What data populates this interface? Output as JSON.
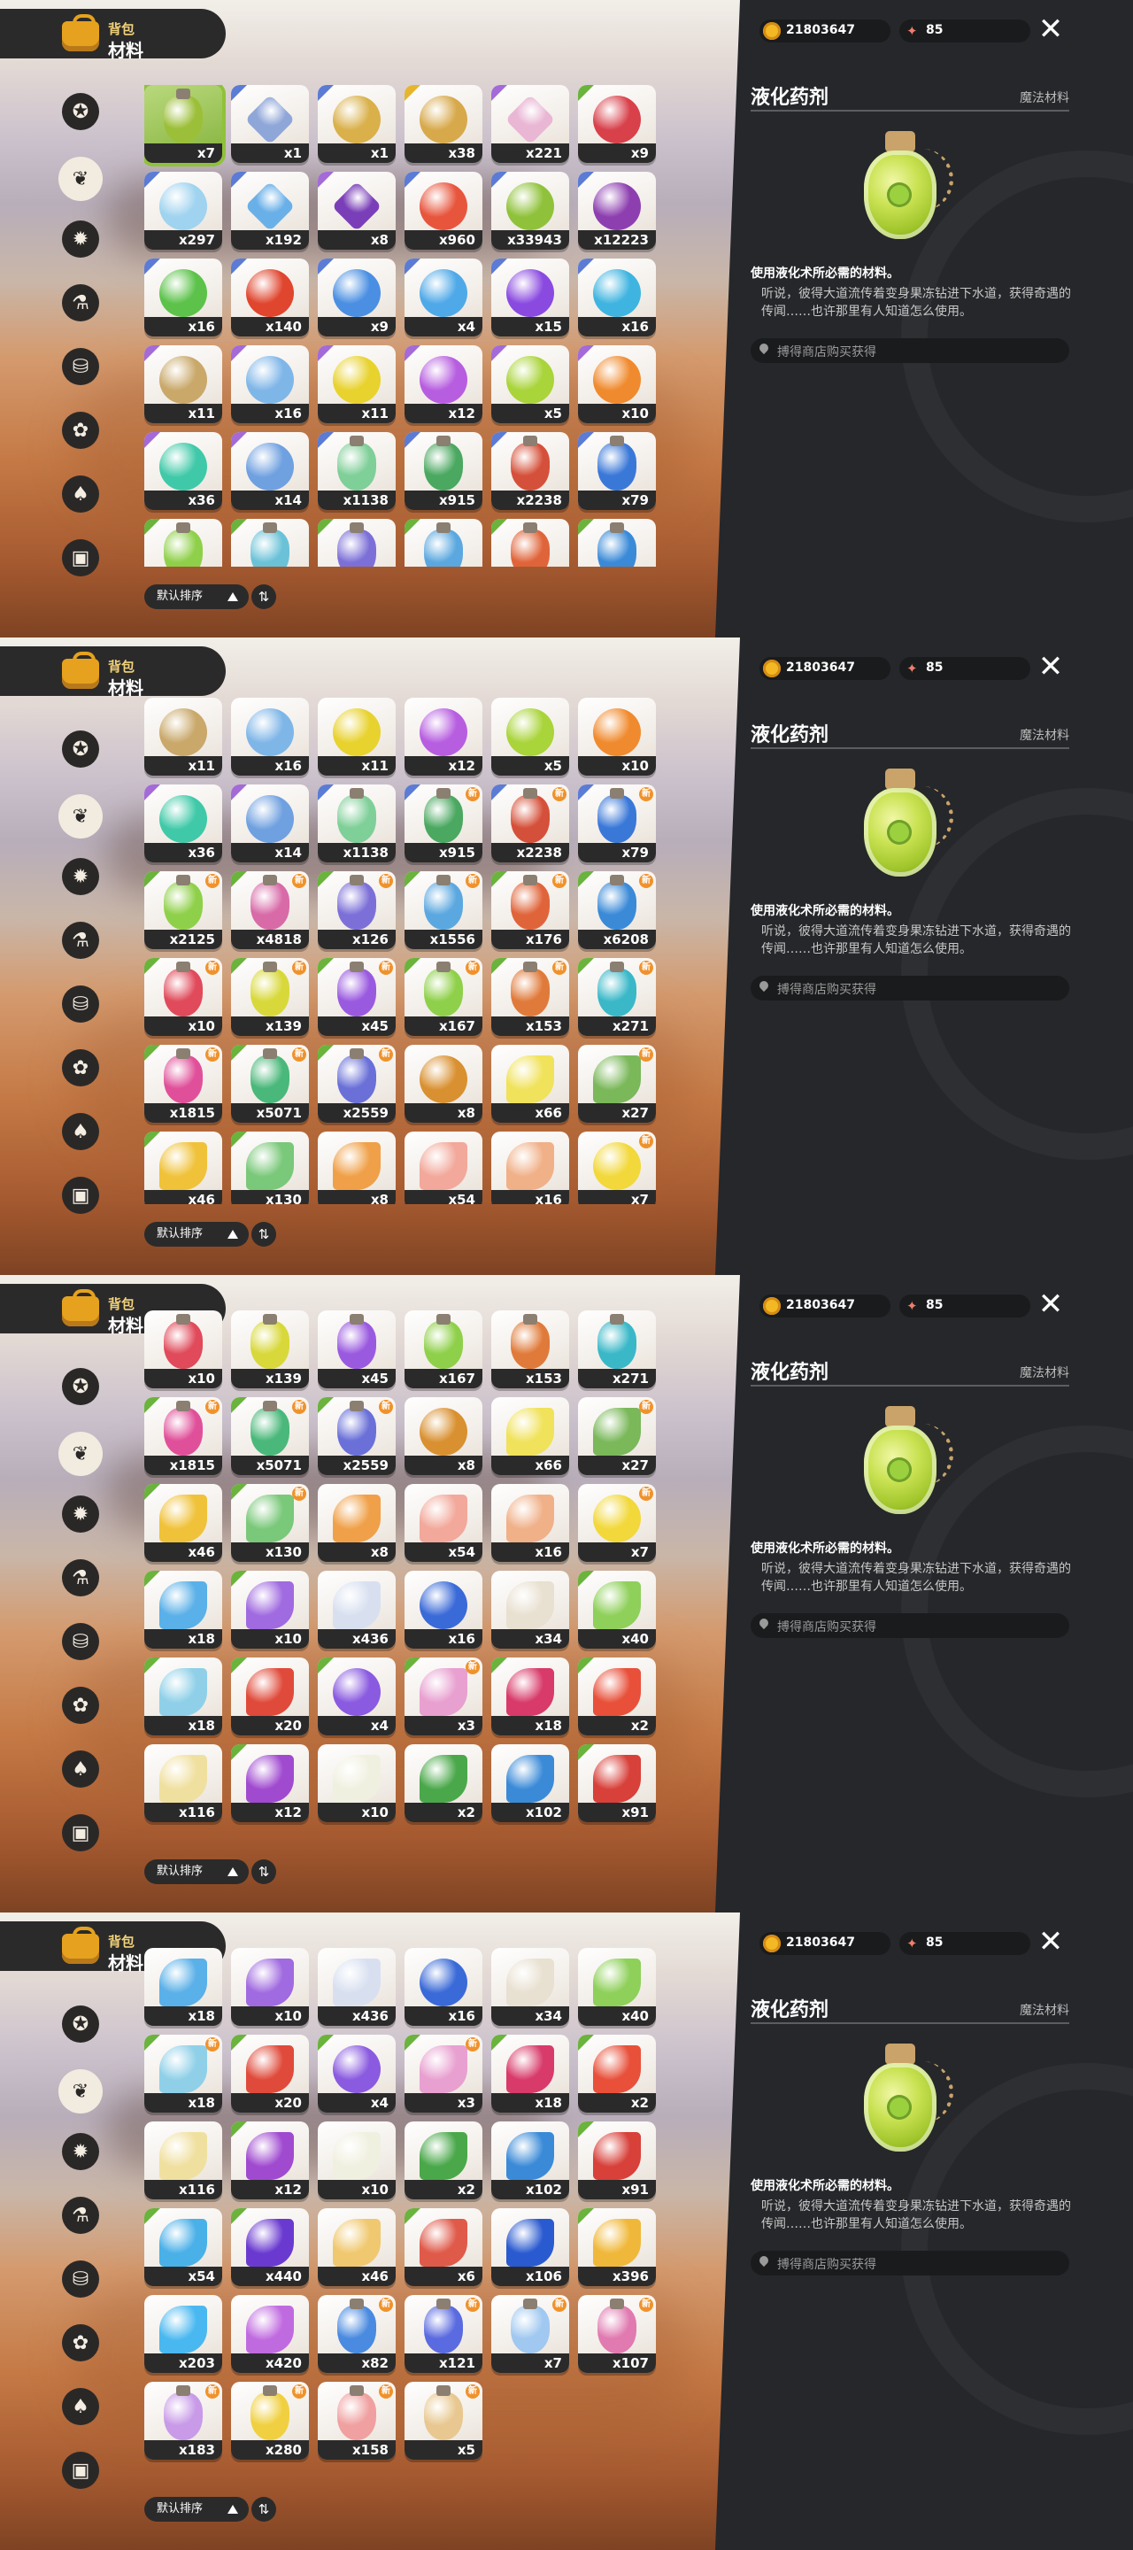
{
  "header": {
    "subtitle": "背包",
    "title": "材料"
  },
  "sidebar_icons": [
    "star-icon",
    "leaf-icon",
    "gear-badge-icon",
    "potion-icon",
    "basket-icon",
    "bell-icon",
    "acorn-icon",
    "chest-icon"
  ],
  "sort": {
    "label": "默认排序",
    "toggle_glyph": "⇅"
  },
  "currency": {
    "coins": "21803647",
    "gems": "85",
    "gem_glyph": "✦",
    "close_glyph": "✕"
  },
  "detail": {
    "name": "液化药剂",
    "category": "魔法材料",
    "desc_title": "使用液化术所必需的材料。",
    "desc_body": "听说，彼得大道流传着变身果冻钻进下水道，获得奇遇的传闻……也许那里有人知道怎么使用。",
    "source": "搏得商店购买获得"
  },
  "palette": {
    "selected_border": "#8fc239",
    "badge": "#f0922c",
    "cell_bar": "#2b2a2a",
    "panel_bg": "#25272a"
  },
  "panels": [
    {
      "rows": [
        [
          {
            "c": "x7",
            "col": "#9cbf3a",
            "s": "vial",
            "sel": true
          },
          {
            "c": "x1",
            "col": "#8fa6d8",
            "s": "gem",
            "t": "#5b7bd5"
          },
          {
            "c": "x1",
            "col": "#d9b04a",
            "s": "round",
            "t": "#5b7bd5"
          },
          {
            "c": "x38",
            "col": "#d7a94b",
            "s": "round",
            "t": "#e6b52c"
          },
          {
            "c": "x221",
            "col": "#e9b6d4",
            "s": "gem",
            "t": "#a36ad8"
          },
          {
            "c": "x9",
            "col": "#d8404a",
            "s": "round",
            "t": "#6ab33c"
          }
        ],
        [
          {
            "c": "x297",
            "col": "#9fd3ef",
            "s": "round",
            "t": "#5b7bd5"
          },
          {
            "c": "x192",
            "col": "#6ab0e8",
            "s": "gem",
            "t": "#5b7bd5"
          },
          {
            "c": "x8",
            "col": "#7a3fb8",
            "s": "gem",
            "t": "#a36ad8"
          },
          {
            "c": "x960",
            "col": "#e8553d",
            "s": "round",
            "t": "#5b7bd5"
          },
          {
            "c": "x33943",
            "col": "#8fc23a",
            "s": "round",
            "t": "#5b7bd5"
          },
          {
            "c": "x12223",
            "col": "#8d3fb0",
            "s": "round",
            "t": "#5b7bd5"
          }
        ],
        [
          {
            "c": "x16",
            "col": "#5cc24a",
            "s": "round",
            "t": "#5b7bd5"
          },
          {
            "c": "x140",
            "col": "#e0452e",
            "s": "round",
            "t": "#5b7bd5"
          },
          {
            "c": "x9",
            "col": "#4a8fe2",
            "s": "round",
            "t": "#5b7bd5"
          },
          {
            "c": "x4",
            "col": "#4fa9e8",
            "s": "round",
            "t": "#5b7bd5"
          },
          {
            "c": "x15",
            "col": "#8a4ae0",
            "s": "round",
            "t": "#5b7bd5"
          },
          {
            "c": "x16",
            "col": "#3fb4e0",
            "s": "round",
            "t": "#5b7bd5"
          }
        ],
        [
          {
            "c": "x11",
            "col": "#c9a86a",
            "s": "round",
            "t": "#a36ad8"
          },
          {
            "c": "x16",
            "col": "#7fb6e8",
            "s": "round",
            "t": "#a36ad8"
          },
          {
            "c": "x11",
            "col": "#e8d22e",
            "s": "round",
            "t": "#a36ad8"
          },
          {
            "c": "x12",
            "col": "#b75ee0",
            "s": "round",
            "t": "#a36ad8"
          },
          {
            "c": "x5",
            "col": "#a9d43a",
            "s": "round",
            "t": "#a36ad8"
          },
          {
            "c": "x10",
            "col": "#f08a2e",
            "s": "round",
            "t": "#a36ad8"
          }
        ],
        [
          {
            "c": "x36",
            "col": "#3fc9a8",
            "s": "round",
            "t": "#a36ad8"
          },
          {
            "c": "x14",
            "col": "#6fa0e0",
            "s": "round",
            "t": "#a36ad8"
          },
          {
            "c": "x1138",
            "col": "#7fcf98",
            "s": "vial",
            "t": "#5b7bd5"
          },
          {
            "c": "x915",
            "col": "#4aa860",
            "s": "vial",
            "t": "#5b7bd5"
          },
          {
            "c": "x2238",
            "col": "#d5503a",
            "s": "vial",
            "t": "#5b7bd5"
          },
          {
            "c": "x79",
            "col": "#3a78d8",
            "s": "vial",
            "t": "#5b7bd5"
          }
        ],
        [
          {
            "c": "",
            "col": "#8fd04a",
            "s": "vial",
            "t": "#6ab33c"
          },
          {
            "c": "",
            "col": "#6bc2d8",
            "s": "vial",
            "t": "#6ab33c"
          },
          {
            "c": "",
            "col": "#7c70d8",
            "s": "vial",
            "t": "#6ab33c"
          },
          {
            "c": "",
            "col": "#5ba8e0",
            "s": "vial",
            "t": "#6ab33c"
          },
          {
            "c": "",
            "col": "#e0643a",
            "s": "vial",
            "t": "#6ab33c"
          },
          {
            "c": "",
            "col": "#3a8ad8",
            "s": "vial",
            "t": "#6ab33c"
          }
        ]
      ]
    },
    {
      "rows": [
        [
          {
            "c": "x11",
            "col": "#c9a86a",
            "s": "round"
          },
          {
            "c": "x16",
            "col": "#7fb6e8",
            "s": "round"
          },
          {
            "c": "x11",
            "col": "#e8d22e",
            "s": "round"
          },
          {
            "c": "x12",
            "col": "#b75ee0",
            "s": "round"
          },
          {
            "c": "x5",
            "col": "#a9d43a",
            "s": "round"
          },
          {
            "c": "x10",
            "col": "#f08a2e",
            "s": "round"
          }
        ],
        [
          {
            "c": "x36",
            "col": "#3fc9a8",
            "s": "round",
            "t": "#a36ad8"
          },
          {
            "c": "x14",
            "col": "#6fa0e0",
            "s": "round",
            "t": "#a36ad8"
          },
          {
            "c": "x1138",
            "col": "#7fcf98",
            "s": "vial",
            "t": "#5b7bd5"
          },
          {
            "c": "x915",
            "col": "#4aa860",
            "s": "vial",
            "t": "#5b7bd5",
            "b": true
          },
          {
            "c": "x2238",
            "col": "#d5503a",
            "s": "vial",
            "t": "#5b7bd5",
            "b": true
          },
          {
            "c": "x79",
            "col": "#3a78d8",
            "s": "vial",
            "t": "#5b7bd5",
            "b": true
          }
        ],
        [
          {
            "c": "x2125",
            "col": "#8fd04a",
            "s": "vial",
            "t": "#6ab33c",
            "b": true
          },
          {
            "c": "x4818",
            "col": "#d86aa8",
            "s": "vial",
            "t": "#6ab33c",
            "b": true
          },
          {
            "c": "x126",
            "col": "#7c70d8",
            "s": "vial",
            "t": "#6ab33c",
            "b": true
          },
          {
            "c": "x1556",
            "col": "#5ba8e0",
            "s": "vial",
            "t": "#6ab33c",
            "b": true
          },
          {
            "c": "x176",
            "col": "#e0643a",
            "s": "vial",
            "t": "#6ab33c",
            "b": true
          },
          {
            "c": "x6208",
            "col": "#3a8ad8",
            "s": "vial",
            "t": "#6ab33c",
            "b": true
          }
        ],
        [
          {
            "c": "x10",
            "col": "#e04a5a",
            "s": "vial",
            "t": "#6ab33c",
            "b": true
          },
          {
            "c": "x139",
            "col": "#d8d83a",
            "s": "vial",
            "t": "#6ab33c",
            "b": true
          },
          {
            "c": "x45",
            "col": "#9a5ae0",
            "s": "vial",
            "t": "#6ab33c",
            "b": true
          },
          {
            "c": "x167",
            "col": "#8fd04a",
            "s": "vial",
            "t": "#6ab33c",
            "b": true
          },
          {
            "c": "x153",
            "col": "#e07a3a",
            "s": "vial",
            "t": "#6ab33c",
            "b": true
          },
          {
            "c": "x271",
            "col": "#3ab8c8",
            "s": "vial",
            "t": "#6ab33c",
            "b": true
          }
        ],
        [
          {
            "c": "x1815",
            "col": "#e0509a",
            "s": "vial",
            "t": "#6ab33c",
            "b": true
          },
          {
            "c": "x5071",
            "col": "#4ab87a",
            "s": "vial",
            "t": "#6ab33c",
            "b": true
          },
          {
            "c": "x2559",
            "col": "#6a70d8",
            "s": "vial",
            "t": "#6ab33c",
            "b": true
          },
          {
            "c": "x8",
            "col": "#d99030",
            "s": "round"
          },
          {
            "c": "x66",
            "col": "#f0e25a",
            "s": "flower"
          },
          {
            "c": "x27",
            "col": "#7ab85a",
            "s": "flower",
            "b": true
          }
        ],
        [
          {
            "c": "x46",
            "col": "#f0c23a",
            "s": "flower",
            "t": "#6ab33c"
          },
          {
            "c": "x130",
            "col": "#7ac87a",
            "s": "flower",
            "t": "#6ab33c"
          },
          {
            "c": "x8",
            "col": "#f0a048",
            "s": "flower"
          },
          {
            "c": "x54",
            "col": "#f2a89a",
            "s": "flower"
          },
          {
            "c": "x16",
            "col": "#f0b088",
            "s": "flower"
          },
          {
            "c": "x7",
            "col": "#f2d83a",
            "s": "round",
            "b": true
          }
        ]
      ]
    },
    {
      "rows": [
        [
          {
            "c": "x10",
            "col": "#e04a5a",
            "s": "vial"
          },
          {
            "c": "x139",
            "col": "#d8d83a",
            "s": "vial"
          },
          {
            "c": "x45",
            "col": "#9a5ae0",
            "s": "vial"
          },
          {
            "c": "x167",
            "col": "#8fd04a",
            "s": "vial"
          },
          {
            "c": "x153",
            "col": "#e07a3a",
            "s": "vial"
          },
          {
            "c": "x271",
            "col": "#3ab8c8",
            "s": "vial"
          }
        ],
        [
          {
            "c": "x1815",
            "col": "#e0509a",
            "s": "vial",
            "t": "#6ab33c",
            "b": true
          },
          {
            "c": "x5071",
            "col": "#4ab87a",
            "s": "vial",
            "t": "#6ab33c",
            "b": true
          },
          {
            "c": "x2559",
            "col": "#6a70d8",
            "s": "vial",
            "t": "#6ab33c",
            "b": true
          },
          {
            "c": "x8",
            "col": "#d99030",
            "s": "round"
          },
          {
            "c": "x66",
            "col": "#f0e25a",
            "s": "flower"
          },
          {
            "c": "x27",
            "col": "#7ab85a",
            "s": "flower",
            "b": true
          }
        ],
        [
          {
            "c": "x46",
            "col": "#f0c23a",
            "s": "flower",
            "t": "#6ab33c"
          },
          {
            "c": "x130",
            "col": "#7ac87a",
            "s": "flower",
            "t": "#6ab33c",
            "b": true
          },
          {
            "c": "x8",
            "col": "#f0a048",
            "s": "flower"
          },
          {
            "c": "x54",
            "col": "#f2a89a",
            "s": "flower"
          },
          {
            "c": "x16",
            "col": "#f0b088",
            "s": "flower"
          },
          {
            "c": "x7",
            "col": "#f2d83a",
            "s": "round",
            "b": true
          }
        ],
        [
          {
            "c": "x18",
            "col": "#5ab0e8",
            "s": "flower",
            "t": "#6ab33c"
          },
          {
            "c": "x10",
            "col": "#a06ae0",
            "s": "flower",
            "t": "#6ab33c"
          },
          {
            "c": "x436",
            "col": "#d8e0f0",
            "s": "flower"
          },
          {
            "c": "x16",
            "col": "#3a6ad8",
            "s": "round"
          },
          {
            "c": "x34",
            "col": "#e8e0d0",
            "s": "flower"
          },
          {
            "c": "x40",
            "col": "#8ed05a",
            "s": "flower",
            "t": "#6ab33c"
          }
        ],
        [
          {
            "c": "x18",
            "col": "#8fd0e8",
            "s": "flower",
            "t": "#6ab33c"
          },
          {
            "c": "x20",
            "col": "#e04a3a",
            "s": "flower",
            "t": "#6ab33c"
          },
          {
            "c": "x4",
            "col": "#8a5ae0",
            "s": "round",
            "t": "#6ab33c"
          },
          {
            "c": "x3",
            "col": "#e8a0d0",
            "s": "flower",
            "t": "#6ab33c",
            "b": true
          },
          {
            "c": "x18",
            "col": "#d83a6a",
            "s": "flower",
            "t": "#6ab33c"
          },
          {
            "c": "x2",
            "col": "#e8503a",
            "s": "flower",
            "t": "#6ab33c"
          }
        ],
        [
          {
            "c": "x116",
            "col": "#f0e0a0",
            "s": "flower"
          },
          {
            "c": "x12",
            "col": "#a04ad0",
            "s": "flower",
            "t": "#6ab33c"
          },
          {
            "c": "x10",
            "col": "#f0f0e0",
            "s": "flower"
          },
          {
            "c": "x2",
            "col": "#4aa84a",
            "s": "flower"
          },
          {
            "c": "x102",
            "col": "#3a8ad8",
            "s": "flower"
          },
          {
            "c": "x91",
            "col": "#d8403a",
            "s": "flower",
            "t": "#6ab33c"
          }
        ]
      ]
    },
    {
      "rows": [
        [
          {
            "c": "x18",
            "col": "#5ab0e8",
            "s": "flower"
          },
          {
            "c": "x10",
            "col": "#a06ae0",
            "s": "flower"
          },
          {
            "c": "x436",
            "col": "#d8e0f0",
            "s": "flower"
          },
          {
            "c": "x16",
            "col": "#3a6ad8",
            "s": "round"
          },
          {
            "c": "x34",
            "col": "#e8e0d0",
            "s": "flower"
          },
          {
            "c": "x40",
            "col": "#8ed05a",
            "s": "flower"
          }
        ],
        [
          {
            "c": "x18",
            "col": "#8fd0e8",
            "s": "flower",
            "t": "#6ab33c",
            "b": true
          },
          {
            "c": "x20",
            "col": "#e04a3a",
            "s": "flower",
            "t": "#6ab33c"
          },
          {
            "c": "x4",
            "col": "#8a5ae0",
            "s": "round",
            "t": "#6ab33c"
          },
          {
            "c": "x3",
            "col": "#e8a0d0",
            "s": "flower",
            "t": "#6ab33c",
            "b": true
          },
          {
            "c": "x18",
            "col": "#d83a6a",
            "s": "flower",
            "t": "#6ab33c"
          },
          {
            "c": "x2",
            "col": "#e8503a",
            "s": "flower",
            "t": "#6ab33c"
          }
        ],
        [
          {
            "c": "x116",
            "col": "#f0e0a0",
            "s": "flower"
          },
          {
            "c": "x12",
            "col": "#a04ad0",
            "s": "flower",
            "t": "#6ab33c"
          },
          {
            "c": "x10",
            "col": "#f0f0e0",
            "s": "flower"
          },
          {
            "c": "x2",
            "col": "#4aa84a",
            "s": "flower"
          },
          {
            "c": "x102",
            "col": "#3a8ad8",
            "s": "flower"
          },
          {
            "c": "x91",
            "col": "#d8403a",
            "s": "flower",
            "t": "#6ab33c"
          }
        ],
        [
          {
            "c": "x54",
            "col": "#4ab0e8",
            "s": "flower",
            "t": "#6ab33c"
          },
          {
            "c": "x440",
            "col": "#6a3ad0",
            "s": "flower",
            "t": "#6ab33c"
          },
          {
            "c": "x46",
            "col": "#f0c870",
            "s": "flower"
          },
          {
            "c": "x6",
            "col": "#e05a4a",
            "s": "flower",
            "t": "#6ab33c"
          },
          {
            "c": "x106",
            "col": "#2a5ad0",
            "s": "flower"
          },
          {
            "c": "x396",
            "col": "#f0b83a",
            "s": "flower",
            "t": "#6ab33c"
          }
        ],
        [
          {
            "c": "x203",
            "col": "#4ab8f0",
            "s": "flower"
          },
          {
            "c": "x420",
            "col": "#c06ae0",
            "s": "flower"
          },
          {
            "c": "x82",
            "col": "#4a8ae0",
            "s": "vial",
            "b": true
          },
          {
            "c": "x121",
            "col": "#5a6ae0",
            "s": "vial",
            "b": true
          },
          {
            "c": "x7",
            "col": "#a0c8f0",
            "s": "vial",
            "b": true
          },
          {
            "c": "x107",
            "col": "#e07ab0",
            "s": "vial",
            "b": true
          }
        ],
        [
          {
            "c": "x183",
            "col": "#c89ae8",
            "s": "vial",
            "b": true
          },
          {
            "c": "x280",
            "col": "#f0d040",
            "s": "vial",
            "b": true
          },
          {
            "c": "x158",
            "col": "#f0a0a0",
            "s": "vial",
            "b": true
          },
          {
            "c": "x5",
            "col": "#e8c890",
            "s": "vial",
            "b": true
          }
        ]
      ]
    }
  ]
}
